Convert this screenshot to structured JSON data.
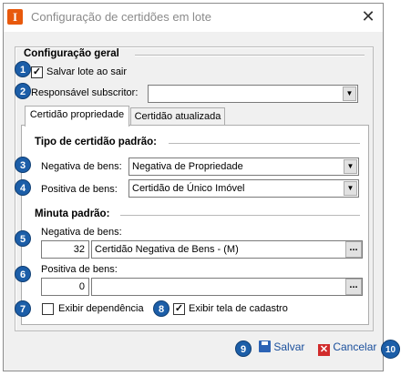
{
  "window": {
    "title": "Configuração de certidões em lote",
    "app_icon_letter": "I",
    "close_glyph": "✕"
  },
  "general": {
    "section_title": "Configuração geral",
    "save_on_exit_label": "Salvar lote ao sair",
    "save_on_exit_checked": true,
    "responsible_label": "Responsável subscritor:",
    "responsible_value": ""
  },
  "tabs": [
    {
      "label": "Certidão propriedade",
      "active": true
    },
    {
      "label": "Certidão atualizada",
      "active": false
    }
  ],
  "cert_type": {
    "section_title": "Tipo de certidão padrão:",
    "negative_label": "Negativa de bens:",
    "negative_value": "Negativa de Propriedade",
    "positive_label": "Positiva de bens:",
    "positive_value": "Certidão de Único Imóvel"
  },
  "minuta": {
    "section_title": "Minuta padrão:",
    "negative_label": "Negativa de bens:",
    "negative_code": "32",
    "negative_name": "Certidão Negativa de Bens - (M)",
    "positive_label": "Positiva de bens:",
    "positive_code": "0",
    "positive_name": ""
  },
  "options": {
    "dependency_label": "Exibir dependência",
    "dependency_checked": false,
    "registration_label": "Exibir tela de cadastro",
    "registration_checked": true
  },
  "actions": {
    "save_label": "Salvar",
    "cancel_label": "Cancelar"
  },
  "badges": [
    "1",
    "2",
    "3",
    "4",
    "5",
    "6",
    "7",
    "8",
    "9",
    "10"
  ],
  "icons": {
    "dropdown": "▼",
    "ellipsis": "...",
    "check": "✓",
    "cancel": "✕"
  },
  "colors": {
    "badge": "#1c5ea8",
    "app_icon": "#e8590c",
    "save_icon": "#2c63b5",
    "cancel_icon": "#d12b2b"
  }
}
